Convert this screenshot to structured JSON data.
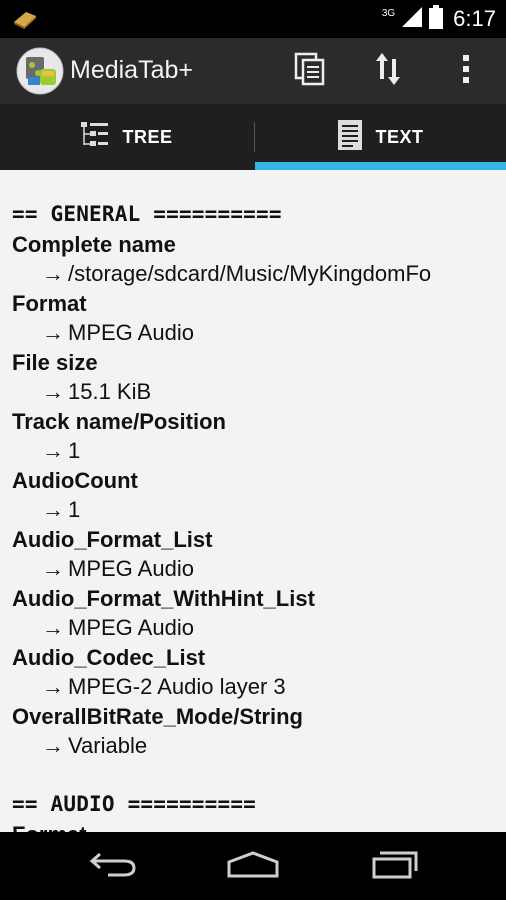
{
  "status_bar": {
    "time": "6:17",
    "network": "3G",
    "icons": [
      "notification-book-icon",
      "signal-icon",
      "battery-icon"
    ]
  },
  "action_bar": {
    "title": "MediaTab+",
    "actions": [
      "copy-icon",
      "sort-icon",
      "overflow-menu-icon"
    ]
  },
  "tabs": [
    {
      "label": "TREE",
      "icon": "tree-icon",
      "selected": false
    },
    {
      "label": "TEXT",
      "icon": "text-icon",
      "selected": true
    }
  ],
  "arrow": "→",
  "sections": [
    {
      "header": "== GENERAL ==========",
      "fields": [
        {
          "key": "Complete name",
          "value": "/storage/sdcard/Music/MyKingdomFo"
        },
        {
          "key": "Format",
          "value": "MPEG Audio"
        },
        {
          "key": "File size",
          "value": "15.1 KiB"
        },
        {
          "key": "Track name/Position",
          "value": "1"
        },
        {
          "key": "AudioCount",
          "value": "1"
        },
        {
          "key": "Audio_Format_List",
          "value": "MPEG Audio"
        },
        {
          "key": "Audio_Format_WithHint_List",
          "value": "MPEG Audio"
        },
        {
          "key": "Audio_Codec_List",
          "value": "MPEG-2 Audio layer 3"
        },
        {
          "key": "OverallBitRate_Mode/String",
          "value": "Variable"
        }
      ]
    },
    {
      "header": "== AUDIO ==========",
      "fields": [
        {
          "key": "Format",
          "value": ""
        }
      ]
    }
  ],
  "colors": {
    "accent": "#33b5e5",
    "action_bar": "#2b2b2b",
    "tab_bar": "#1f1f1f",
    "content_bg": "#f3f3f3"
  }
}
